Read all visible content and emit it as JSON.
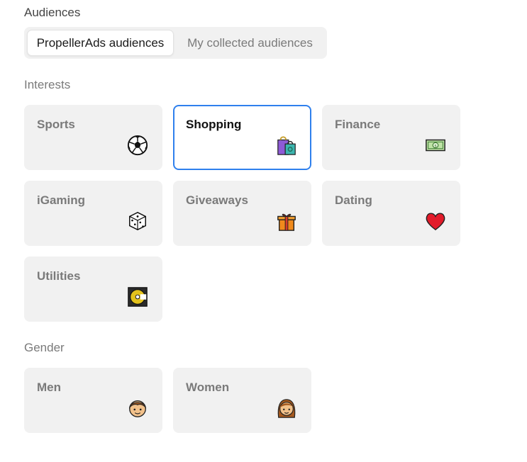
{
  "audiences": {
    "label": "Audiences",
    "tabs": [
      {
        "label": "PropellerAds audiences",
        "active": true
      },
      {
        "label": "My collected audiences",
        "active": false
      }
    ]
  },
  "interests": {
    "label": "Interests",
    "cards": [
      {
        "label": "Sports",
        "icon": "soccer-ball-icon",
        "selected": false
      },
      {
        "label": "Shopping",
        "icon": "shopping-bag-icon",
        "selected": true
      },
      {
        "label": "Finance",
        "icon": "money-icon",
        "selected": false
      },
      {
        "label": "iGaming",
        "icon": "dice-icon",
        "selected": false
      },
      {
        "label": "Giveaways",
        "icon": "gift-icon",
        "selected": false
      },
      {
        "label": "Dating",
        "icon": "heart-icon",
        "selected": false
      },
      {
        "label": "Utilities",
        "icon": "disc-icon",
        "selected": false
      }
    ]
  },
  "gender": {
    "label": "Gender",
    "cards": [
      {
        "label": "Men",
        "icon": "man-icon",
        "selected": false
      },
      {
        "label": "Women",
        "icon": "woman-icon",
        "selected": false
      }
    ]
  },
  "colors": {
    "selected_border": "#2f80ed",
    "card_bg": "#f1f1f1"
  }
}
